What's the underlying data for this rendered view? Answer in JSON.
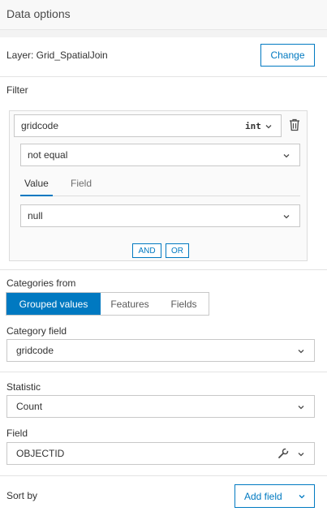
{
  "header": {
    "title": "Data options"
  },
  "layer": {
    "label": "Layer: Grid_SpatialJoin",
    "change_label": "Change"
  },
  "filter": {
    "section_label": "Filter",
    "field_name": "gridcode",
    "field_type": "int",
    "operator": "not equal",
    "tabs": [
      {
        "label": "Value"
      },
      {
        "label": "Field"
      }
    ],
    "value": "null",
    "and_label": "AND",
    "or_label": "OR"
  },
  "categories": {
    "section_label": "Categories from",
    "options": [
      {
        "label": "Grouped values"
      },
      {
        "label": "Features"
      },
      {
        "label": "Fields"
      }
    ],
    "selected": "Grouped values"
  },
  "category_field": {
    "label": "Category field",
    "value": "gridcode"
  },
  "statistic": {
    "label": "Statistic",
    "value": "Count"
  },
  "field": {
    "label": "Field",
    "value": "OBJECTID"
  },
  "sort": {
    "label": "Sort by",
    "add_field_label": "Add field"
  },
  "colors": {
    "accent": "#0079c1",
    "border": "#c8c8c8",
    "section_gap": "#f3f3f3"
  }
}
